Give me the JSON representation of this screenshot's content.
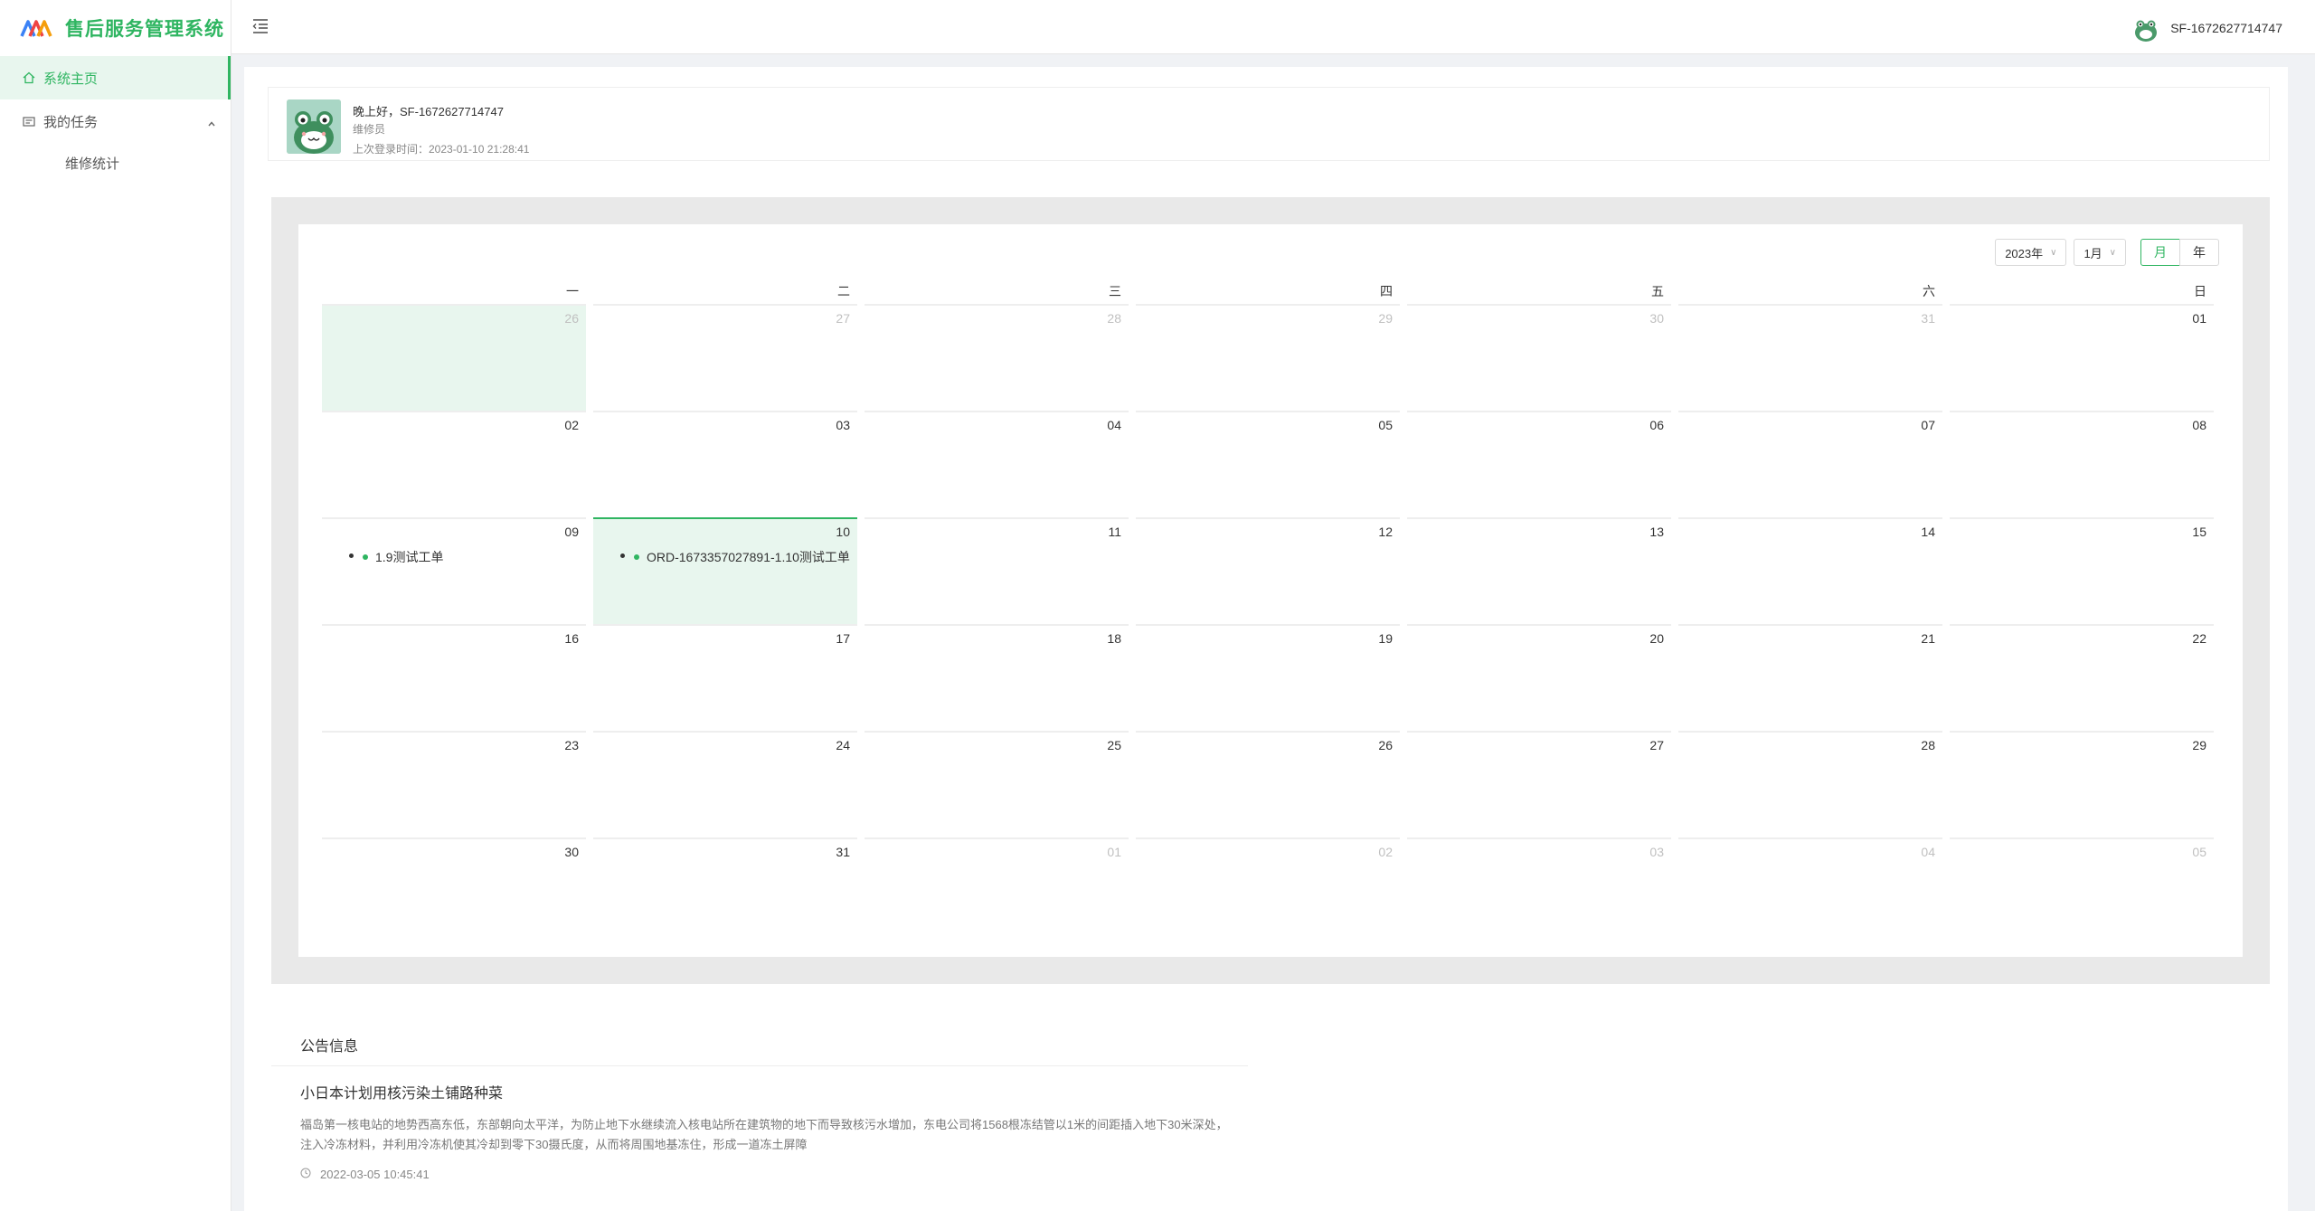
{
  "app": {
    "title": "售后服务管理系统"
  },
  "sidebar": {
    "items": [
      {
        "label": "系统主页",
        "icon": "home-icon",
        "active": true
      },
      {
        "label": "我的任务",
        "icon": "task-icon",
        "expanded": true,
        "children": [
          {
            "label": "维修统计"
          }
        ]
      }
    ]
  },
  "header": {
    "username": "SF-1672627714747"
  },
  "welcome": {
    "greeting": "晚上好，SF-1672627714747",
    "role": "维修员",
    "last_login": "上次登录时间：2023-01-10 21:28:41"
  },
  "calendar": {
    "year_label": "2023年",
    "month_label": "1月",
    "mode_month": "月",
    "mode_year": "年",
    "weekdays": [
      "一",
      "二",
      "三",
      "四",
      "五",
      "六",
      "日"
    ],
    "weeks": [
      [
        {
          "n": "26",
          "other": true,
          "selected": true
        },
        {
          "n": "27",
          "other": true
        },
        {
          "n": "28",
          "other": true
        },
        {
          "n": "29",
          "other": true
        },
        {
          "n": "30",
          "other": true
        },
        {
          "n": "31",
          "other": true
        },
        {
          "n": "01"
        }
      ],
      [
        {
          "n": "02"
        },
        {
          "n": "03"
        },
        {
          "n": "04"
        },
        {
          "n": "05"
        },
        {
          "n": "06"
        },
        {
          "n": "07"
        },
        {
          "n": "08"
        }
      ],
      [
        {
          "n": "09",
          "event": "1.9测试工单"
        },
        {
          "n": "10",
          "today": true,
          "event": "ORD-1673357027891-1.10测试工单"
        },
        {
          "n": "11"
        },
        {
          "n": "12"
        },
        {
          "n": "13"
        },
        {
          "n": "14"
        },
        {
          "n": "15"
        }
      ],
      [
        {
          "n": "16"
        },
        {
          "n": "17"
        },
        {
          "n": "18"
        },
        {
          "n": "19"
        },
        {
          "n": "20"
        },
        {
          "n": "21"
        },
        {
          "n": "22"
        }
      ],
      [
        {
          "n": "23"
        },
        {
          "n": "24"
        },
        {
          "n": "25"
        },
        {
          "n": "26"
        },
        {
          "n": "27"
        },
        {
          "n": "28"
        },
        {
          "n": "29"
        }
      ],
      [
        {
          "n": "30"
        },
        {
          "n": "31"
        },
        {
          "n": "01",
          "other": true
        },
        {
          "n": "02",
          "other": true
        },
        {
          "n": "03",
          "other": true
        },
        {
          "n": "04",
          "other": true
        },
        {
          "n": "05",
          "other": true
        }
      ]
    ]
  },
  "notice": {
    "title": "公告信息",
    "items": [
      {
        "title": "小日本计划用核污染土铺路种菜",
        "body": "福岛第一核电站的地势西高东低，东部朝向太平洋，为防止地下水继续流入核电站所在建筑物的地下而导致核污水增加，东电公司将1568根冻结管以1米的间距插入地下30米深处，注入冷冻材料，并利用冷冻机使其冷却到零下30摄氏度，从而将周围地基冻住，形成一道冻土屏障",
        "time": "2022-03-05 10:45:41"
      }
    ]
  },
  "colors": {
    "accent": "#2fb561",
    "accent_light": "#e8f6ee",
    "outer_bg": "#e9e9e9"
  }
}
